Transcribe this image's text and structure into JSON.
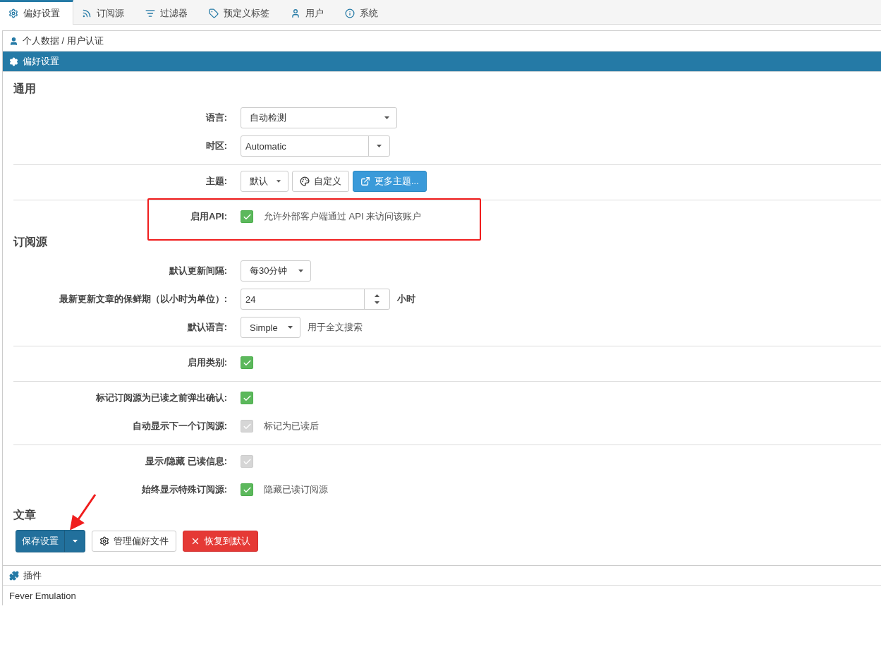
{
  "tabs": [
    {
      "label": "偏好设置",
      "selected": true
    },
    {
      "label": "订阅源",
      "selected": false
    },
    {
      "label": "过滤器",
      "selected": false
    },
    {
      "label": "预定义标签",
      "selected": false
    },
    {
      "label": "用户",
      "selected": false
    },
    {
      "label": "系统",
      "selected": false
    }
  ],
  "accordion_top": [
    {
      "title": "个人数据 / 用户认证",
      "expanded": false
    },
    {
      "title": "偏好设置",
      "expanded": true
    }
  ],
  "sections": [
    {
      "title": "通用",
      "groups": [
        [
          {
            "kind": "select",
            "label": "语言:",
            "value": "自动检测"
          },
          {
            "kind": "combo",
            "label": "时区:",
            "value": "Automatic"
          }
        ],
        [
          {
            "kind": "theme",
            "label": "主题:",
            "value": "默认",
            "buttons": [
              {
                "label": "自定义"
              },
              {
                "label": "更多主题..."
              }
            ]
          }
        ],
        [
          {
            "kind": "checkbox",
            "label": "启用API:",
            "checked": true,
            "disabled": false,
            "note": "允许外部客户端通过 API 来访问该账户",
            "highlighted": true
          }
        ]
      ]
    },
    {
      "title": "订阅源",
      "groups": [
        [
          {
            "kind": "select",
            "label": "默认更新间隔:",
            "value": "每30分钟"
          },
          {
            "kind": "number",
            "label": "最新更新文章的保鲜期（以小时为单位）:",
            "value": "24",
            "suffix": "小时"
          },
          {
            "kind": "select",
            "label": "默认语言:",
            "value": "Simple",
            "note": "用于全文搜索"
          }
        ],
        [
          {
            "kind": "checkbox",
            "label": "启用类别:",
            "checked": true,
            "disabled": false
          }
        ],
        [
          {
            "kind": "checkbox",
            "label": "标记订阅源为已读之前弹出确认:",
            "checked": true,
            "disabled": false
          },
          {
            "kind": "checkbox",
            "label": "自动显示下一个订阅源:",
            "checked": true,
            "disabled": true,
            "note": "标记为已读后"
          }
        ],
        [
          {
            "kind": "checkbox",
            "label": "显示/隐藏 已读信息:",
            "checked": true,
            "disabled": true
          },
          {
            "kind": "checkbox",
            "label": "始终显示特殊订阅源:",
            "checked": true,
            "disabled": false,
            "note": "隐藏已读订阅源"
          }
        ]
      ]
    },
    {
      "title": "文章"
    }
  ],
  "actions": [
    {
      "kind": "split",
      "label": "保存设置",
      "pointed": true
    },
    {
      "kind": "default",
      "label": "管理偏好文件"
    },
    {
      "kind": "danger",
      "label": "恢复到默认"
    }
  ],
  "accordion_bottom": [
    {
      "title": "插件",
      "expanded": false
    }
  ],
  "plugins": [
    {
      "label": "Fever Emulation"
    }
  ]
}
